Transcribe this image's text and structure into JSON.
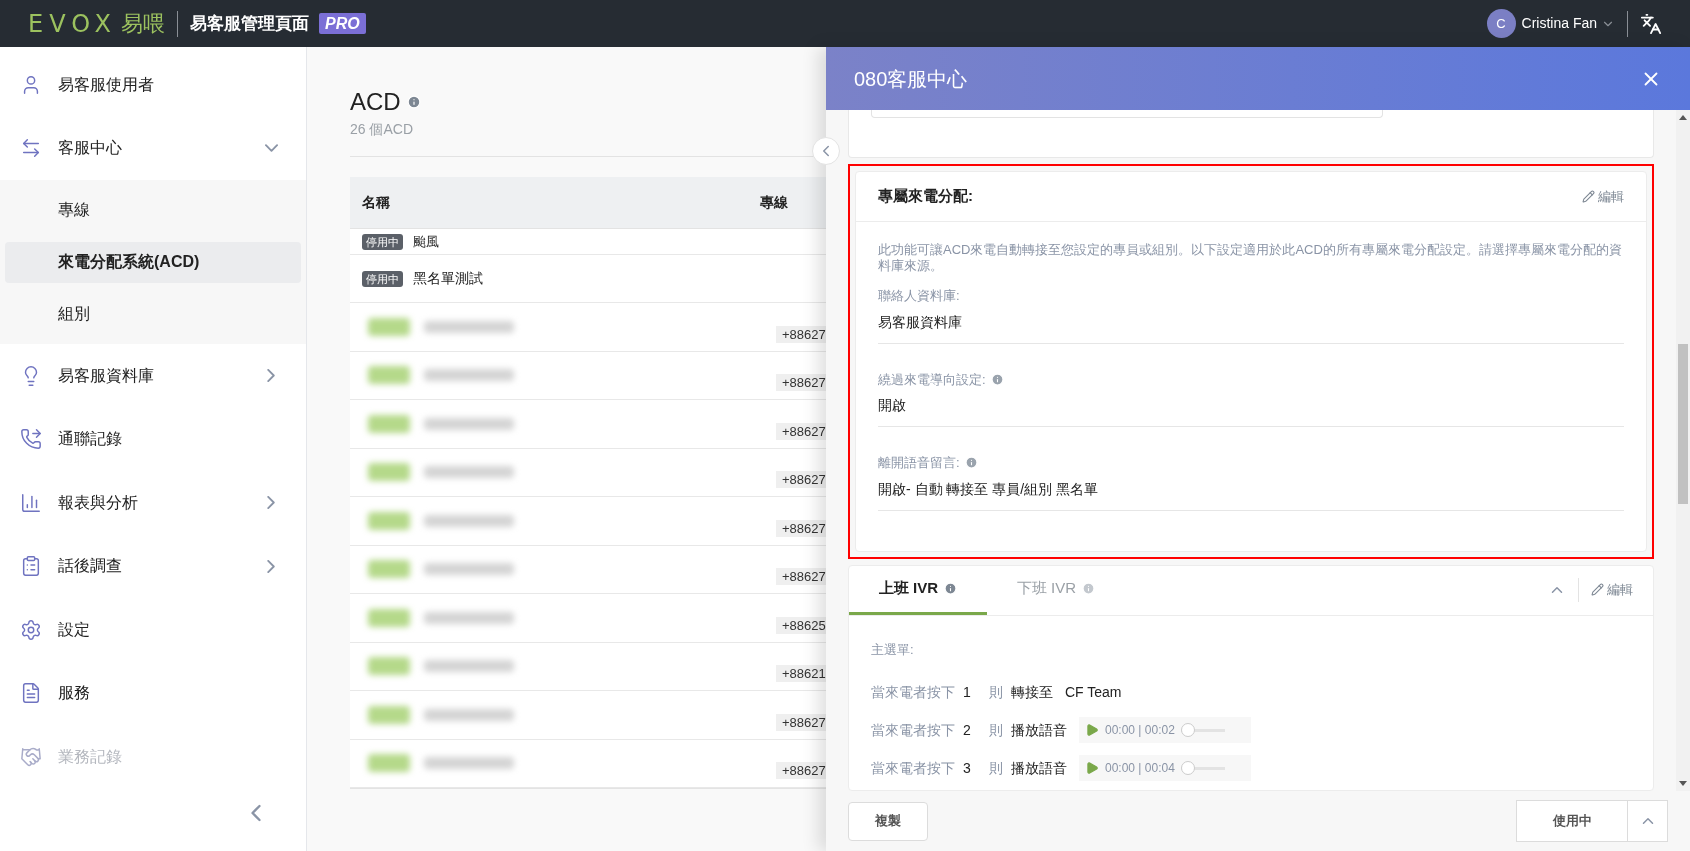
{
  "header": {
    "logo": "EVOX",
    "logo_cn": "易喂",
    "title": "易客服管理頁面",
    "badge": "PRO",
    "user": {
      "initial": "C",
      "name": "Cristina Fan"
    }
  },
  "sidebar": {
    "items": [
      {
        "label": "易客服使用者",
        "disabled": false
      },
      {
        "label": "客服中心",
        "expanded": true,
        "disabled": false,
        "children": [
          {
            "label": "專線",
            "selected": false
          },
          {
            "label": "來電分配系統(ACD)",
            "selected": true
          },
          {
            "label": "組別",
            "selected": false
          }
        ]
      },
      {
        "label": "易客服資料庫",
        "expanded": false,
        "disabled": false
      },
      {
        "label": "通聯記錄",
        "disabled": false
      },
      {
        "label": "報表與分析",
        "expanded": false,
        "disabled": false
      },
      {
        "label": "話後調查",
        "expanded": false,
        "disabled": false
      },
      {
        "label": "設定",
        "disabled": false
      },
      {
        "label": "服務",
        "disabled": false
      },
      {
        "label": "業務記錄",
        "disabled": true
      }
    ]
  },
  "page": {
    "title": "ACD",
    "subtitle": "26 個ACD",
    "table": {
      "columns": [
        "名稱",
        "專線"
      ],
      "rows": [
        {
          "kind": "partial",
          "status": "停用中",
          "name": "颱風"
        },
        {
          "kind": "plain",
          "status": "停用中",
          "name": "黑名單測試"
        },
        {
          "kind": "redacted",
          "phone": "+88627"
        },
        {
          "kind": "redacted",
          "phone": "+88627"
        },
        {
          "kind": "redacted",
          "phone": "+88627"
        },
        {
          "kind": "redacted",
          "phone": "+88627"
        },
        {
          "kind": "redacted",
          "phone": "+88627"
        },
        {
          "kind": "redacted",
          "phone": "+88627"
        },
        {
          "kind": "redacted",
          "phone": "+88625"
        },
        {
          "kind": "redacted",
          "phone": "+88621"
        },
        {
          "kind": "redacted",
          "phone": "+88627"
        },
        {
          "kind": "redacted",
          "phone": "+88627"
        }
      ]
    }
  },
  "drawer": {
    "title": "080客服中心",
    "section": {
      "title": "專屬來電分配:",
      "edit": "編輯",
      "description": "此功能可讓ACD來電自動轉接至您設定的專員或組別。以下設定適用於此ACD的所有專屬來電分配設定。請選擇專屬來電分配的資料庫來源。",
      "fields": [
        {
          "label": "聯絡人資料庫:",
          "value": "易客服資料庫",
          "info": false
        },
        {
          "label": "繞過來電導向設定:",
          "value": "開啟",
          "info": true
        },
        {
          "label": "離開語音留言:",
          "value": "開啟- 自動 轉接至 專員/組別 黑名單",
          "info": true
        }
      ]
    },
    "ivr": {
      "tabs": [
        {
          "label": "上班 IVR",
          "selected": true
        },
        {
          "label": "下班 IVR",
          "selected": false
        }
      ],
      "edit": "編輯",
      "menu_label": "主選單:",
      "rows": [
        {
          "kind": "transfer",
          "prefix": "當來電者按下",
          "key": "1",
          "then": "則",
          "action": "轉接至",
          "target": "CF Team"
        },
        {
          "kind": "audio",
          "prefix": "當來電者按下",
          "key": "2",
          "then": "則",
          "action": "播放語音",
          "time": "00:00 | 00:02",
          "level": 0
        },
        {
          "kind": "audio",
          "prefix": "當來電者按下",
          "key": "3",
          "then": "則",
          "action": "播放語音",
          "time": "00:00 | 00:04",
          "level": 0
        }
      ]
    },
    "footer": {
      "copy": "複製",
      "status": "使用中"
    }
  }
}
